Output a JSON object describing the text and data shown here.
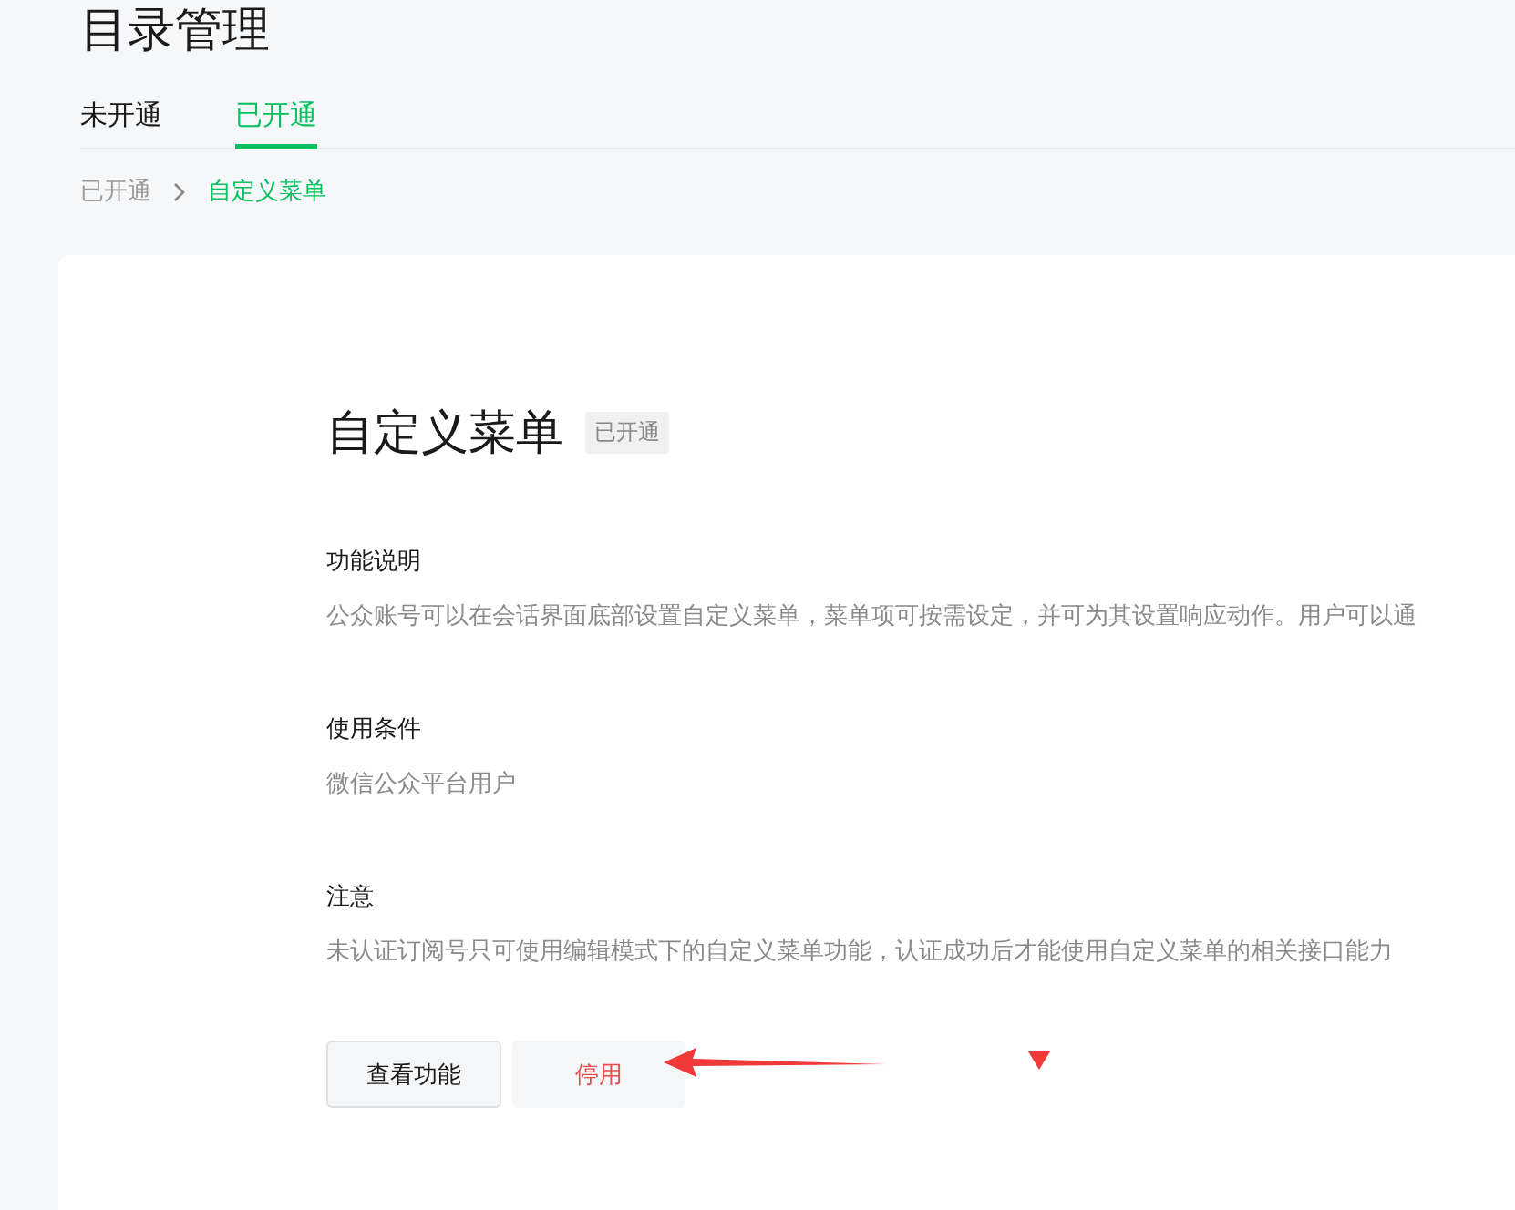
{
  "page_title": "目录管理",
  "tabs": [
    {
      "label": "未开通",
      "selected": false
    },
    {
      "label": "已开通",
      "selected": true
    }
  ],
  "breadcrumb": [
    {
      "label": "已开通",
      "current": false
    },
    {
      "label": "自定义菜单",
      "current": true
    }
  ],
  "feature": {
    "title": "自定义菜单",
    "badge": "已开通",
    "sections": [
      {
        "heading": "功能说明",
        "text": "公众账号可以在会话界面底部设置自定义菜单，菜单项可按需设定，并可为其设置响应动作。用户可以通"
      },
      {
        "heading": "使用条件",
        "text": "微信公众平台用户"
      },
      {
        "heading": "注意",
        "text": "未认证订阅号只可使用编辑模式下的自定义菜单功能，认证成功后才能使用自定义菜单的相关接口能力"
      }
    ],
    "buttons": [
      {
        "label": "查看功能",
        "kind": "default"
      },
      {
        "label": "停用",
        "kind": "danger"
      }
    ]
  }
}
